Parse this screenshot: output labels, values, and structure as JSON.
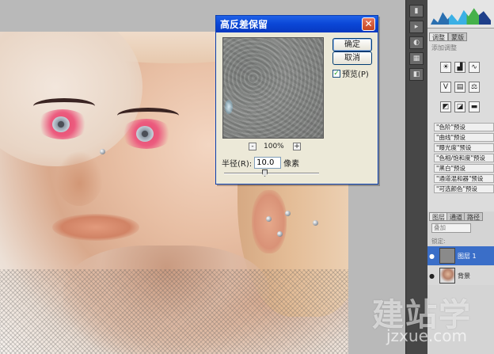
{
  "dialog": {
    "title": "高反差保留",
    "ok_label": "确定",
    "cancel_label": "取消",
    "preview_label": "预览(P)",
    "preview_checked": true,
    "zoom": "100%",
    "zoom_minus": "-",
    "zoom_plus": "+",
    "radius_label": "半径(R):",
    "radius_value": "10.0",
    "radius_unit": "像素",
    "close_glyph": "✕"
  },
  "panels": {
    "adjust_tab": "调整",
    "mask_tab": "蒙版",
    "adjust_subtitle": "添加调整",
    "presets": [
      "\"色阶\"预设",
      "\"曲线\"预设",
      "\"曝光度\"预设",
      "\"色相/饱和度\"预设",
      "\"黑白\"预设",
      "\"通道混和器\"预设",
      "\"可选颜色\"预设"
    ],
    "layers_tabs": [
      "图层",
      "通道",
      "路径"
    ],
    "blend_mode": "叠加",
    "lock_label": "锁定:",
    "layers": [
      {
        "name": "图层 1",
        "selected": true
      },
      {
        "name": "背景",
        "selected": false
      }
    ]
  },
  "watermark": {
    "text": "建站学",
    "url": "jzxue.com"
  }
}
